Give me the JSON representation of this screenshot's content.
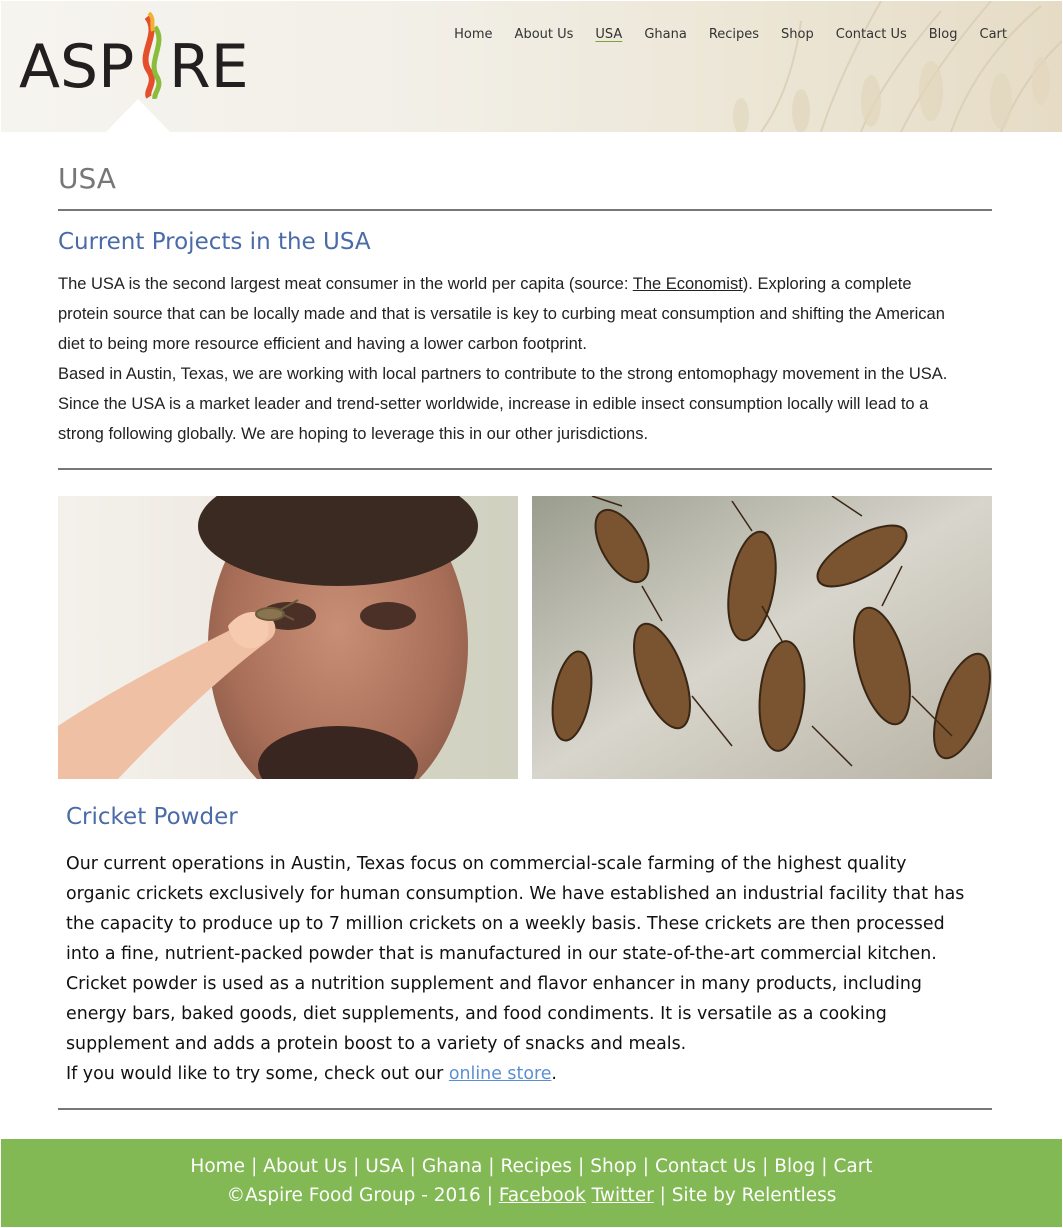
{
  "brand": {
    "logo_text_left": "ASP",
    "logo_text_right": "RE"
  },
  "nav": {
    "items": [
      {
        "label": "Home"
      },
      {
        "label": "About Us"
      },
      {
        "label": "USA"
      },
      {
        "label": "Ghana"
      },
      {
        "label": "Recipes"
      },
      {
        "label": "Shop"
      },
      {
        "label": "Contact Us"
      },
      {
        "label": "Blog"
      },
      {
        "label": "Cart"
      }
    ],
    "active": "USA"
  },
  "page": {
    "title": "USA"
  },
  "projects": {
    "heading": "Current Projects in the USA",
    "p1_before": "The USA is the second largest meat consumer in the world per capita (source: ",
    "p1_link": "The Economist",
    "p1_after": "). Exploring a complete protein source that can be locally made and that is versatile is key to curbing meat consumption and shifting the American diet to being more resource efficient and having a lower carbon footprint.",
    "p2": "Based in Austin, Texas, we are working with local partners to contribute to the strong entomophagy movement in the USA. Since the USA is a market leader and trend-setter worldwide, increase in edible insect consumption locally will lead to a strong following globally. We are hoping to leverage this in our other jurisdictions."
  },
  "powder": {
    "heading": "Cricket Powder",
    "p1": "Our current operations in Austin, Texas focus on commercial-scale farming of the highest quality organic crickets exclusively for human consumption. We have established an industrial facility that has the capacity to produce up to 7 million crickets on a weekly basis. These crickets are then processed into a fine, nutrient-packed powder that is manufactured in our state-of-the-art commercial kitchen. Cricket powder is used as a nutrition supplement and flavor enhancer in many products, including energy bars, baked goods, diet supplements, and food condiments. It is versatile as a cooking supplement and adds a protein boost to a variety of snacks and meals.",
    "p2_before": "If you would like to try some, check out our ",
    "p2_link": "online store",
    "p2_after": "."
  },
  "footer": {
    "links": [
      "Home",
      "About Us",
      "USA",
      "Ghana",
      "Recipes",
      "Shop",
      "Contact Us",
      "Blog",
      "Cart"
    ],
    "separator": "|",
    "copyright": "©Aspire Food Group - 2016 |",
    "facebook": "Facebook",
    "twitter": "Twitter",
    "credit": "| Site by Relentless"
  },
  "colors": {
    "heading_blue": "#4a6ba8",
    "footer_green": "#82b955",
    "link_blue": "#5b8fd1",
    "nav_active_underline": "#7aa23e"
  }
}
